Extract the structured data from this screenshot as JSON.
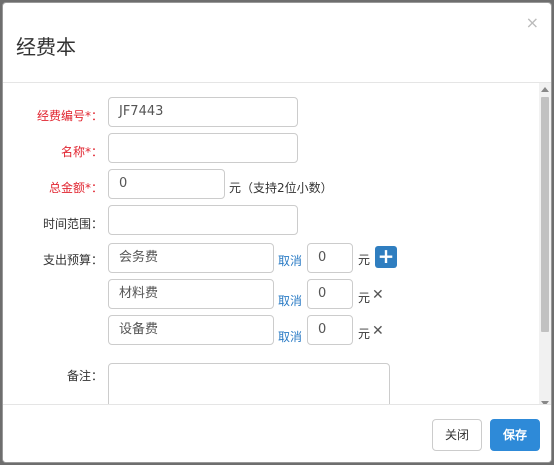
{
  "dialog": {
    "title": "经费本",
    "close_glyph": "×"
  },
  "form": {
    "code": {
      "label": "经费编号*：",
      "value": "JF7443"
    },
    "name": {
      "label": "名称*：",
      "value": ""
    },
    "total": {
      "label": "总金额*：",
      "value": "0",
      "suffix": "元（支持2位小数）"
    },
    "time_range": {
      "label": "时间范围：",
      "value": ""
    },
    "budget": {
      "label": "支出预算：",
      "items": [
        {
          "name": "会务费",
          "cancel": "取消",
          "amount": "0",
          "unit": "元"
        },
        {
          "name": "材料费",
          "cancel": "取消",
          "amount": "0",
          "unit": "元"
        },
        {
          "name": "设备费",
          "cancel": "取消",
          "amount": "0",
          "unit": "元"
        }
      ],
      "add_icon": "plus-icon",
      "delete_icon": "close-icon"
    },
    "note": {
      "label": "备注：",
      "value": ""
    }
  },
  "footer": {
    "close_label": "关闭",
    "save_label": "保存"
  },
  "colors": {
    "required": "#e1242f",
    "link": "#2a7bc5",
    "primary": "#2e8ad8"
  }
}
